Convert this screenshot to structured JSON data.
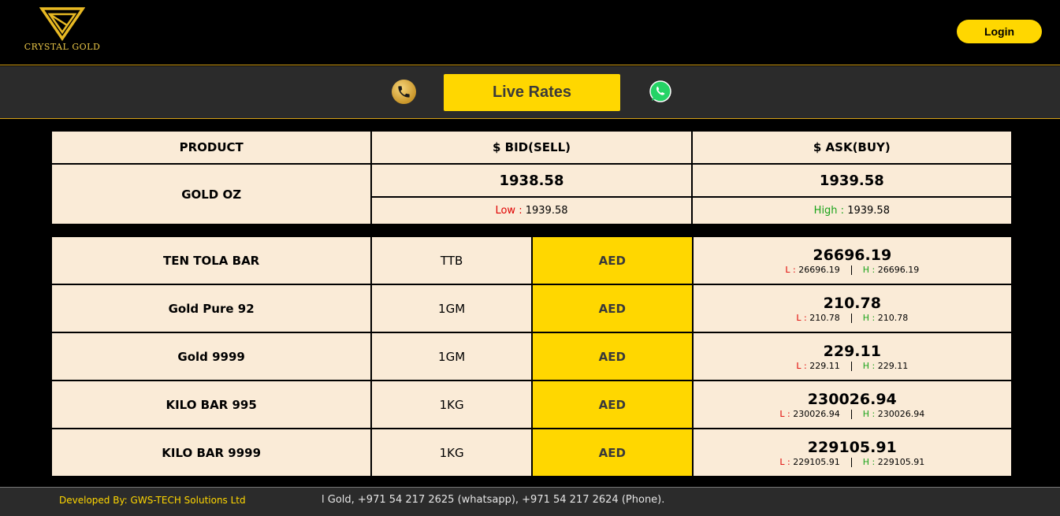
{
  "brand": {
    "name": "CRYSTAL GOLD"
  },
  "header": {
    "login_label": "Login"
  },
  "subbar": {
    "live_rates_label": "Live Rates",
    "phone_icon": "phone-icon",
    "whatsapp_icon": "whatsapp-icon"
  },
  "colors": {
    "accent": "#ffd700",
    "cream": "#faebd7",
    "low": "#e00000",
    "high": "#1aa31a"
  },
  "spot_table": {
    "headers": [
      "PRODUCT",
      "$ BID(SELL)",
      "$ ASK(BUY)"
    ],
    "product": "GOLD OZ",
    "bid": "1938.58",
    "ask": "1939.58",
    "low_label": "Low :",
    "low_value": "1939.58",
    "high_label": "High :",
    "high_value": "1939.58"
  },
  "products": [
    {
      "name": "TEN TOLA BAR",
      "unit": "TTB",
      "currency": "AED",
      "price": "26696.19",
      "low_label": "L :",
      "low": "26696.19",
      "high_label": "H :",
      "high": "26696.19"
    },
    {
      "name": "Gold Pure 92",
      "unit": "1GM",
      "currency": "AED",
      "price": "210.78",
      "low_label": "L :",
      "low": "210.78",
      "high_label": "H :",
      "high": "210.78"
    },
    {
      "name": "Gold 9999",
      "unit": "1GM",
      "currency": "AED",
      "price": "229.11",
      "low_label": "L :",
      "low": "229.11",
      "high_label": "H :",
      "high": "229.11"
    },
    {
      "name": "KILO BAR 995",
      "unit": "1KG",
      "currency": "AED",
      "price": "230026.94",
      "low_label": "L :",
      "low": "230026.94",
      "high_label": "H :",
      "high": "230026.94"
    },
    {
      "name": "KILO BAR 9999",
      "unit": "1KG",
      "currency": "AED",
      "price": "229105.91",
      "low_label": "L :",
      "low": "229105.91",
      "high_label": "H :",
      "high": "229105.91"
    }
  ],
  "footer": {
    "developer": "Developed By: GWS-TECH Solutions Ltd",
    "ticker": "l Gold, +971 54 217 2625 (whatsapp), +971 54 217 2624 (Phone)."
  }
}
